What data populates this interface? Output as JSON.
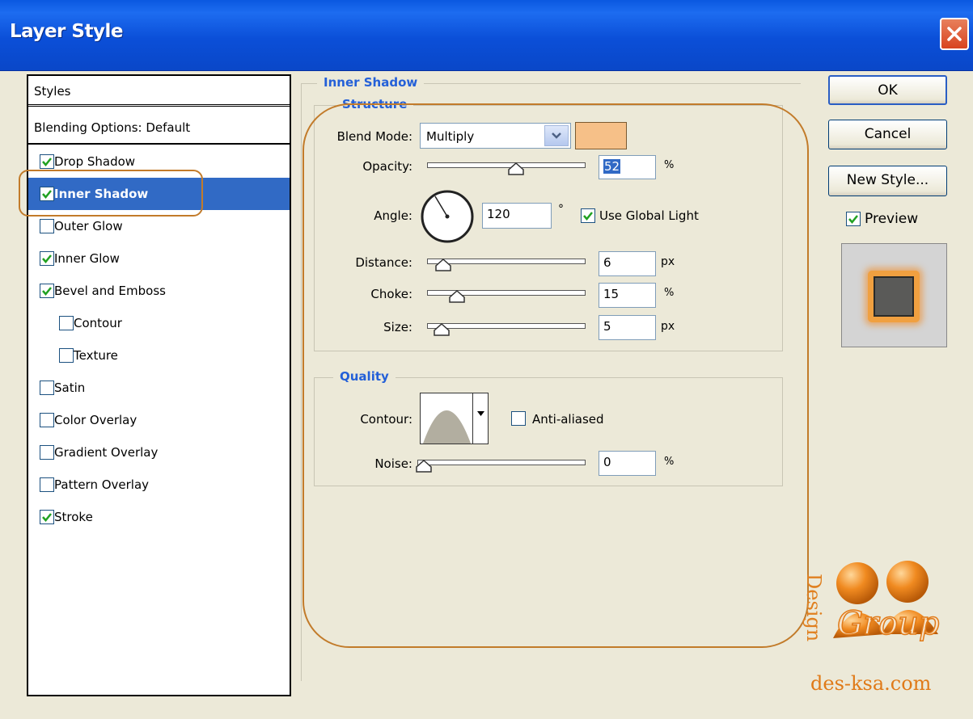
{
  "window": {
    "title": "Layer Style"
  },
  "styles_panel": {
    "header": "Styles",
    "blending_options": "Blending Options: Default",
    "items": [
      {
        "label": "Drop Shadow",
        "checked": true,
        "indent": false,
        "selected": false
      },
      {
        "label": "Inner Shadow",
        "checked": true,
        "indent": false,
        "selected": true
      },
      {
        "label": "Outer Glow",
        "checked": false,
        "indent": false,
        "selected": false
      },
      {
        "label": "Inner Glow",
        "checked": true,
        "indent": false,
        "selected": false
      },
      {
        "label": "Bevel and Emboss",
        "checked": true,
        "indent": false,
        "selected": false
      },
      {
        "label": "Contour",
        "checked": false,
        "indent": true,
        "selected": false
      },
      {
        "label": "Texture",
        "checked": false,
        "indent": true,
        "selected": false
      },
      {
        "label": "Satin",
        "checked": false,
        "indent": false,
        "selected": false
      },
      {
        "label": "Color Overlay",
        "checked": false,
        "indent": false,
        "selected": false
      },
      {
        "label": "Gradient Overlay",
        "checked": false,
        "indent": false,
        "selected": false
      },
      {
        "label": "Pattern Overlay",
        "checked": false,
        "indent": false,
        "selected": false
      },
      {
        "label": "Stroke",
        "checked": true,
        "indent": false,
        "selected": false
      }
    ]
  },
  "inner_shadow": {
    "section_title": "Inner Shadow",
    "structure": {
      "title": "Structure",
      "blend_mode_label": "Blend Mode:",
      "blend_mode_value": "Multiply",
      "color_swatch": "#f6c088",
      "opacity_label": "Opacity:",
      "opacity_value": "52",
      "opacity_unit": "%",
      "angle_label": "Angle:",
      "angle_value": "120",
      "angle_unit": "°",
      "use_global_light_label": "Use Global Light",
      "use_global_light_checked": true,
      "distance_label": "Distance:",
      "distance_value": "6",
      "distance_unit": "px",
      "choke_label": "Choke:",
      "choke_value": "15",
      "choke_unit": "%",
      "size_label": "Size:",
      "size_value": "5",
      "size_unit": "px"
    },
    "quality": {
      "title": "Quality",
      "contour_label": "Contour:",
      "anti_aliased_label": "Anti-aliased",
      "anti_aliased_checked": false,
      "noise_label": "Noise:",
      "noise_value": "0",
      "noise_unit": "%"
    },
    "slider_levels": {
      "opacity": 0.52,
      "distance": 0.06,
      "choke": 0.15,
      "size": 0.05,
      "noise": 0.0
    }
  },
  "buttons": {
    "ok": "OK",
    "cancel": "Cancel",
    "new_style": "New Style...",
    "preview_label": "Preview",
    "preview_checked": true
  },
  "watermark": {
    "site": "des-ksa.com"
  },
  "colors": {
    "accent": "#316ac5",
    "highlight_outline": "#c27b2a",
    "legend_text": "#2460d8"
  }
}
